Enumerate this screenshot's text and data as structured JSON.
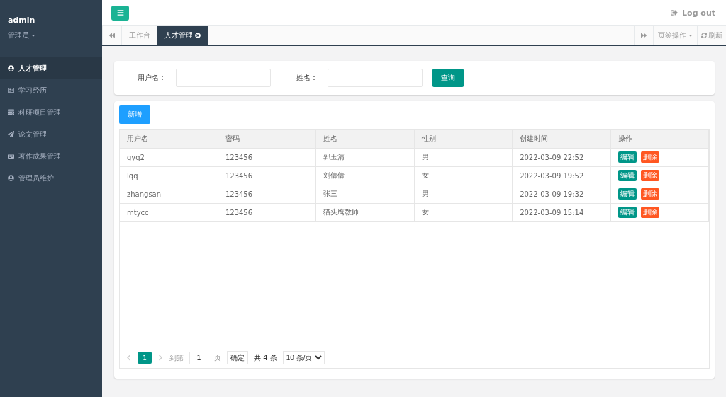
{
  "user": {
    "name": "admin",
    "role": "管理员"
  },
  "nav": [
    {
      "label": "人才管理",
      "selected": true
    },
    {
      "label": "学习经历",
      "selected": false
    },
    {
      "label": "科研项目管理",
      "selected": false
    },
    {
      "label": "论文管理",
      "selected": false
    },
    {
      "label": "著作成果管理",
      "selected": false
    },
    {
      "label": "管理员维护",
      "selected": false
    }
  ],
  "logout": "Log out",
  "tabs": [
    {
      "label": "工作台",
      "selected": false,
      "closable": false
    },
    {
      "label": "人才管理",
      "selected": true,
      "closable": true
    }
  ],
  "tab_actions": {
    "menu": "页签操作",
    "refresh": "刷新"
  },
  "search": {
    "fields": [
      {
        "label": "用户名："
      },
      {
        "label": "姓名："
      }
    ],
    "button": "查询"
  },
  "add_button": "新增",
  "table": {
    "columns": [
      "用户名",
      "密码",
      "姓名",
      "性别",
      "创建时间",
      "操作"
    ],
    "rows": [
      {
        "cells": [
          "gyq2",
          "123456",
          "郭玉清",
          "男",
          "2022-03-09 22:52"
        ],
        "actions": [
          "编辑",
          "删除"
        ]
      },
      {
        "cells": [
          "lqq",
          "123456",
          "刘倩倩",
          "女",
          "2022-03-09 19:52"
        ],
        "actions": [
          "编辑",
          "删除"
        ]
      },
      {
        "cells": [
          "zhangsan",
          "123456",
          "张三",
          "男",
          "2022-03-09 19:32"
        ],
        "actions": [
          "编辑",
          "删除"
        ]
      },
      {
        "cells": [
          "mtycc",
          "123456",
          "猫头鹰教师",
          "女",
          "2022-03-09 15:14"
        ],
        "actions": [
          "编辑",
          "删除"
        ]
      }
    ]
  },
  "pagination": {
    "pages": [
      {
        "label": "1",
        "selected": true
      }
    ],
    "goto_label": "到第",
    "goto_value": "1",
    "page_unit": "页",
    "confirm": "确定",
    "total": "共 4 条",
    "page_size": "10 条/页"
  }
}
